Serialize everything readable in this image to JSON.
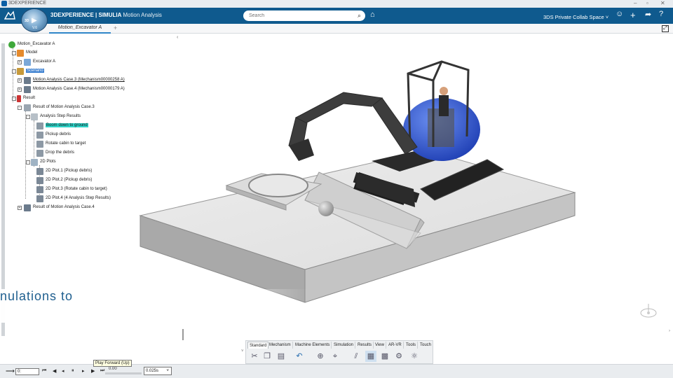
{
  "titlebar": {
    "app_name": "3DEXPERIENCE"
  },
  "topbar": {
    "brand_bold": "3DEXPERIENCE | SIMULIA",
    "brand_app": "Motion Analysis",
    "search_placeholder": "Search",
    "collab_space": "3DS Private Collab Space",
    "compass_version": "V.6"
  },
  "tabs": {
    "active": "Motion_Excavator A",
    "add": "+"
  },
  "tree": {
    "root": "Motion_Excavator A",
    "model": "Model",
    "excavator": "Excavator A",
    "scenario": "Scenario",
    "case3": "Motion Analysis Case.3 (Mechanism00000258 A)",
    "case4": "Motion Analysis Case.4 (Mechanism00000179 A)",
    "result": "Result",
    "result_case3": "Result of Motion Analysis Case.3",
    "step_results": "Analysis Step Results",
    "steps": [
      "Boom down to ground",
      "Pickup debris",
      "Rotate cabin to target",
      "Drop the debris"
    ],
    "plots_folder": "2D Plots",
    "plots": [
      "2D Plot.1 (Pickup debris)",
      "2D Plot.2 (Pickup debris)",
      "2D Plot.3 (Rotate cabin to target)",
      "2D Plot.4 (4 Analysis Step Results)"
    ],
    "result_case4": "Result of Motion Analysis Case.4"
  },
  "caption": "nulations  to",
  "command_bar": {
    "tabs": [
      "Standard",
      "Mechanism",
      "Machine Elements",
      "Simulation",
      "Results",
      "View",
      "AR-VR",
      "Tools",
      "Touch"
    ],
    "active_tab": "Standard"
  },
  "player": {
    "input_value": "0:",
    "tooltip": "Play Forward (Up)",
    "time": "0.00",
    "step": "0.025s"
  },
  "colors": {
    "topbar": "#0f5a8e",
    "highlight": "#2dd3c8",
    "accent": "#1f5f8f"
  }
}
